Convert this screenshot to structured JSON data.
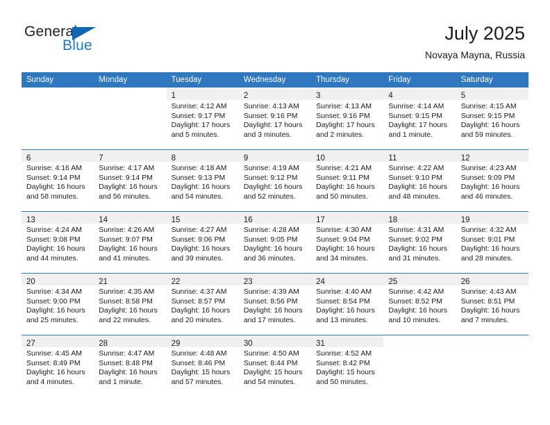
{
  "brand": {
    "name_top": "General",
    "name_bottom": "Blue",
    "accent_color": "#1b79c9",
    "triangle_color": "#0c68b4"
  },
  "header": {
    "title": "July 2025",
    "subtitle": "Novaya Mayna, Russia"
  },
  "theme": {
    "header_row_color": "#2f78bf",
    "date_band_color": "#f0f0f0",
    "text_color": "#1a1a1a"
  },
  "weekday_headers": [
    "Sunday",
    "Monday",
    "Tuesday",
    "Wednesday",
    "Thursday",
    "Friday",
    "Saturday"
  ],
  "weeks": [
    [
      {
        "empty": true
      },
      {
        "empty": true
      },
      {
        "day": "1",
        "sunrise": "Sunrise: 4:12 AM",
        "sunset": "Sunset: 9:17 PM",
        "daylight": "Daylight: 17 hours and 5 minutes."
      },
      {
        "day": "2",
        "sunrise": "Sunrise: 4:13 AM",
        "sunset": "Sunset: 9:16 PM",
        "daylight": "Daylight: 17 hours and 3 minutes."
      },
      {
        "day": "3",
        "sunrise": "Sunrise: 4:13 AM",
        "sunset": "Sunset: 9:16 PM",
        "daylight": "Daylight: 17 hours and 2 minutes."
      },
      {
        "day": "4",
        "sunrise": "Sunrise: 4:14 AM",
        "sunset": "Sunset: 9:15 PM",
        "daylight": "Daylight: 17 hours and 1 minute."
      },
      {
        "day": "5",
        "sunrise": "Sunrise: 4:15 AM",
        "sunset": "Sunset: 9:15 PM",
        "daylight": "Daylight: 16 hours and 59 minutes."
      }
    ],
    [
      {
        "day": "6",
        "sunrise": "Sunrise: 4:16 AM",
        "sunset": "Sunset: 9:14 PM",
        "daylight": "Daylight: 16 hours and 58 minutes."
      },
      {
        "day": "7",
        "sunrise": "Sunrise: 4:17 AM",
        "sunset": "Sunset: 9:14 PM",
        "daylight": "Daylight: 16 hours and 56 minutes."
      },
      {
        "day": "8",
        "sunrise": "Sunrise: 4:18 AM",
        "sunset": "Sunset: 9:13 PM",
        "daylight": "Daylight: 16 hours and 54 minutes."
      },
      {
        "day": "9",
        "sunrise": "Sunrise: 4:19 AM",
        "sunset": "Sunset: 9:12 PM",
        "daylight": "Daylight: 16 hours and 52 minutes."
      },
      {
        "day": "10",
        "sunrise": "Sunrise: 4:21 AM",
        "sunset": "Sunset: 9:11 PM",
        "daylight": "Daylight: 16 hours and 50 minutes."
      },
      {
        "day": "11",
        "sunrise": "Sunrise: 4:22 AM",
        "sunset": "Sunset: 9:10 PM",
        "daylight": "Daylight: 16 hours and 48 minutes."
      },
      {
        "day": "12",
        "sunrise": "Sunrise: 4:23 AM",
        "sunset": "Sunset: 9:09 PM",
        "daylight": "Daylight: 16 hours and 46 minutes."
      }
    ],
    [
      {
        "day": "13",
        "sunrise": "Sunrise: 4:24 AM",
        "sunset": "Sunset: 9:08 PM",
        "daylight": "Daylight: 16 hours and 44 minutes."
      },
      {
        "day": "14",
        "sunrise": "Sunrise: 4:26 AM",
        "sunset": "Sunset: 9:07 PM",
        "daylight": "Daylight: 16 hours and 41 minutes."
      },
      {
        "day": "15",
        "sunrise": "Sunrise: 4:27 AM",
        "sunset": "Sunset: 9:06 PM",
        "daylight": "Daylight: 16 hours and 39 minutes."
      },
      {
        "day": "16",
        "sunrise": "Sunrise: 4:28 AM",
        "sunset": "Sunset: 9:05 PM",
        "daylight": "Daylight: 16 hours and 36 minutes."
      },
      {
        "day": "17",
        "sunrise": "Sunrise: 4:30 AM",
        "sunset": "Sunset: 9:04 PM",
        "daylight": "Daylight: 16 hours and 34 minutes."
      },
      {
        "day": "18",
        "sunrise": "Sunrise: 4:31 AM",
        "sunset": "Sunset: 9:02 PM",
        "daylight": "Daylight: 16 hours and 31 minutes."
      },
      {
        "day": "19",
        "sunrise": "Sunrise: 4:32 AM",
        "sunset": "Sunset: 9:01 PM",
        "daylight": "Daylight: 16 hours and 28 minutes."
      }
    ],
    [
      {
        "day": "20",
        "sunrise": "Sunrise: 4:34 AM",
        "sunset": "Sunset: 9:00 PM",
        "daylight": "Daylight: 16 hours and 25 minutes."
      },
      {
        "day": "21",
        "sunrise": "Sunrise: 4:35 AM",
        "sunset": "Sunset: 8:58 PM",
        "daylight": "Daylight: 16 hours and 22 minutes."
      },
      {
        "day": "22",
        "sunrise": "Sunrise: 4:37 AM",
        "sunset": "Sunset: 8:57 PM",
        "daylight": "Daylight: 16 hours and 20 minutes."
      },
      {
        "day": "23",
        "sunrise": "Sunrise: 4:39 AM",
        "sunset": "Sunset: 8:56 PM",
        "daylight": "Daylight: 16 hours and 17 minutes."
      },
      {
        "day": "24",
        "sunrise": "Sunrise: 4:40 AM",
        "sunset": "Sunset: 8:54 PM",
        "daylight": "Daylight: 16 hours and 13 minutes."
      },
      {
        "day": "25",
        "sunrise": "Sunrise: 4:42 AM",
        "sunset": "Sunset: 8:52 PM",
        "daylight": "Daylight: 16 hours and 10 minutes."
      },
      {
        "day": "26",
        "sunrise": "Sunrise: 4:43 AM",
        "sunset": "Sunset: 8:51 PM",
        "daylight": "Daylight: 16 hours and 7 minutes."
      }
    ],
    [
      {
        "day": "27",
        "sunrise": "Sunrise: 4:45 AM",
        "sunset": "Sunset: 8:49 PM",
        "daylight": "Daylight: 16 hours and 4 minutes."
      },
      {
        "day": "28",
        "sunrise": "Sunrise: 4:47 AM",
        "sunset": "Sunset: 8:48 PM",
        "daylight": "Daylight: 16 hours and 1 minute."
      },
      {
        "day": "29",
        "sunrise": "Sunrise: 4:48 AM",
        "sunset": "Sunset: 8:46 PM",
        "daylight": "Daylight: 15 hours and 57 minutes."
      },
      {
        "day": "30",
        "sunrise": "Sunrise: 4:50 AM",
        "sunset": "Sunset: 8:44 PM",
        "daylight": "Daylight: 15 hours and 54 minutes."
      },
      {
        "day": "31",
        "sunrise": "Sunrise: 4:52 AM",
        "sunset": "Sunset: 8:42 PM",
        "daylight": "Daylight: 15 hours and 50 minutes."
      },
      {
        "empty": true
      },
      {
        "empty": true
      }
    ]
  ]
}
